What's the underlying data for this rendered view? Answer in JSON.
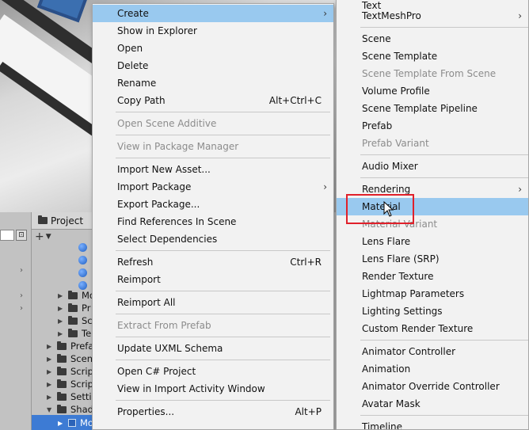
{
  "project_panel": {
    "tab_label": "Project",
    "add_label": "+",
    "items": [
      {
        "label": "Mo",
        "kind": "folder"
      },
      {
        "label": "Pr",
        "kind": "folder"
      },
      {
        "label": "Sc",
        "kind": "folder"
      },
      {
        "label": "Te",
        "kind": "folder"
      },
      {
        "label": "Prefa",
        "kind": "folder"
      },
      {
        "label": "Scen",
        "kind": "folder"
      },
      {
        "label": "Scrip",
        "kind": "folder"
      },
      {
        "label": "Scrip",
        "kind": "folder"
      },
      {
        "label": "Setti",
        "kind": "folder"
      },
      {
        "label": "Shad",
        "kind": "folder"
      },
      {
        "label": "MovingVisual",
        "kind": "prefab"
      }
    ]
  },
  "context_menu": {
    "items": [
      {
        "label": "Create",
        "shortcut": "",
        "has_submenu": true,
        "disabled": false,
        "highlighted": true
      },
      {
        "label": "Show in Explorer",
        "shortcut": "",
        "has_submenu": false,
        "disabled": false
      },
      {
        "label": "Open",
        "shortcut": "",
        "has_submenu": false,
        "disabled": false
      },
      {
        "label": "Delete",
        "shortcut": "",
        "has_submenu": false,
        "disabled": false
      },
      {
        "label": "Rename",
        "shortcut": "",
        "has_submenu": false,
        "disabled": false
      },
      {
        "label": "Copy Path",
        "shortcut": "Alt+Ctrl+C",
        "has_submenu": false,
        "disabled": false
      },
      {
        "label": "Open Scene Additive",
        "shortcut": "",
        "has_submenu": false,
        "disabled": true
      },
      {
        "label": "View in Package Manager",
        "shortcut": "",
        "has_submenu": false,
        "disabled": true
      },
      {
        "label": "Import New Asset...",
        "shortcut": "",
        "has_submenu": false,
        "disabled": false
      },
      {
        "label": "Import Package",
        "shortcut": "",
        "has_submenu": true,
        "disabled": false
      },
      {
        "label": "Export Package...",
        "shortcut": "",
        "has_submenu": false,
        "disabled": false
      },
      {
        "label": "Find References In Scene",
        "shortcut": "",
        "has_submenu": false,
        "disabled": false
      },
      {
        "label": "Select Dependencies",
        "shortcut": "",
        "has_submenu": false,
        "disabled": false
      },
      {
        "label": "Refresh",
        "shortcut": "Ctrl+R",
        "has_submenu": false,
        "disabled": false
      },
      {
        "label": "Reimport",
        "shortcut": "",
        "has_submenu": false,
        "disabled": false
      },
      {
        "label": "Reimport All",
        "shortcut": "",
        "has_submenu": false,
        "disabled": false
      },
      {
        "label": "Extract From Prefab",
        "shortcut": "",
        "has_submenu": false,
        "disabled": true
      },
      {
        "label": "Update UXML Schema",
        "shortcut": "",
        "has_submenu": false,
        "disabled": false
      },
      {
        "label": "Open C# Project",
        "shortcut": "",
        "has_submenu": false,
        "disabled": false
      },
      {
        "label": "View in Import Activity Window",
        "shortcut": "",
        "has_submenu": false,
        "disabled": false
      },
      {
        "label": "Properties...",
        "shortcut": "Alt+P",
        "has_submenu": false,
        "disabled": false
      }
    ]
  },
  "create_submenu": {
    "items": [
      {
        "label": "Text",
        "disabled": false,
        "has_submenu": false
      },
      {
        "label": "TextMeshPro",
        "disabled": false,
        "has_submenu": true
      },
      {
        "label": "Scene",
        "disabled": false,
        "has_submenu": false
      },
      {
        "label": "Scene Template",
        "disabled": false,
        "has_submenu": false
      },
      {
        "label": "Scene Template From Scene",
        "disabled": true,
        "has_submenu": false
      },
      {
        "label": "Volume Profile",
        "disabled": false,
        "has_submenu": false
      },
      {
        "label": "Scene Template Pipeline",
        "disabled": false,
        "has_submenu": false
      },
      {
        "label": "Prefab",
        "disabled": false,
        "has_submenu": false
      },
      {
        "label": "Prefab Variant",
        "disabled": true,
        "has_submenu": false
      },
      {
        "label": "Audio Mixer",
        "disabled": false,
        "has_submenu": false
      },
      {
        "label": "Rendering",
        "disabled": false,
        "has_submenu": true
      },
      {
        "label": "Material",
        "disabled": false,
        "has_submenu": false,
        "highlighted": true
      },
      {
        "label": "Material Variant",
        "disabled": true,
        "has_submenu": false
      },
      {
        "label": "Lens Flare",
        "disabled": false,
        "has_submenu": false
      },
      {
        "label": "Lens Flare (SRP)",
        "disabled": false,
        "has_submenu": false
      },
      {
        "label": "Render Texture",
        "disabled": false,
        "has_submenu": false
      },
      {
        "label": "Lightmap Parameters",
        "disabled": false,
        "has_submenu": false
      },
      {
        "label": "Lighting Settings",
        "disabled": false,
        "has_submenu": false
      },
      {
        "label": "Custom Render Texture",
        "disabled": false,
        "has_submenu": false
      },
      {
        "label": "Animator Controller",
        "disabled": false,
        "has_submenu": false
      },
      {
        "label": "Animation",
        "disabled": false,
        "has_submenu": false
      },
      {
        "label": "Animator Override Controller",
        "disabled": false,
        "has_submenu": false
      },
      {
        "label": "Avatar Mask",
        "disabled": false,
        "has_submenu": false
      },
      {
        "label": "Timeline",
        "disabled": false,
        "has_submenu": false
      }
    ]
  },
  "colors": {
    "menu_highlight": "#99c9ef",
    "disabled_text": "#8c8c8c",
    "annotation": "#e0202a",
    "selection": "#3d7bd4"
  }
}
